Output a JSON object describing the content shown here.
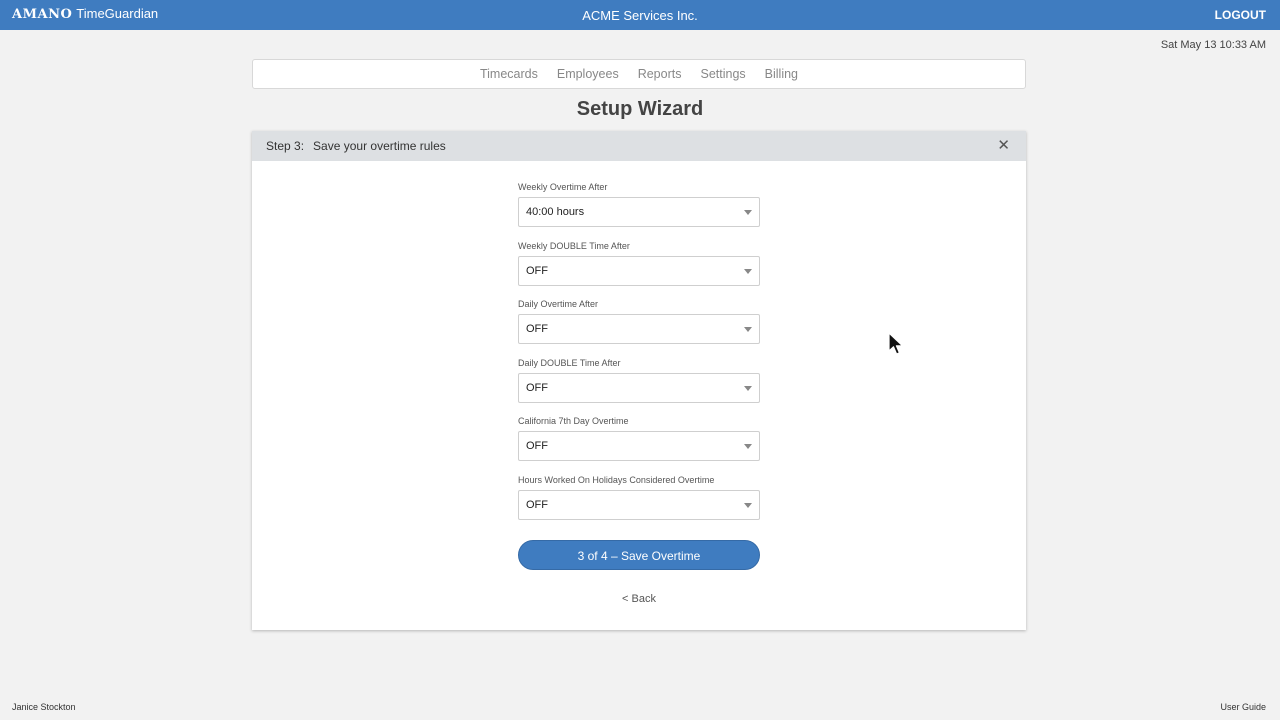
{
  "header": {
    "brand_primary": "AMANO",
    "brand_secondary": "TimeGuardian",
    "company": "ACME Services Inc.",
    "logout_label": "LOGOUT",
    "datetime": "Sat May 13 10:33 AM"
  },
  "nav": {
    "items": [
      {
        "label": "Timecards"
      },
      {
        "label": "Employees"
      },
      {
        "label": "Reports"
      },
      {
        "label": "Settings"
      },
      {
        "label": "Billing"
      }
    ]
  },
  "page": {
    "title": "Setup Wizard"
  },
  "wizard": {
    "step_number": "Step 3:",
    "step_title": "Save your overtime rules",
    "close_glyph": "✕",
    "fields": [
      {
        "label": "Weekly Overtime After",
        "value": "40:00 hours"
      },
      {
        "label": "Weekly DOUBLE Time After",
        "value": "OFF"
      },
      {
        "label": "Daily Overtime After",
        "value": "OFF"
      },
      {
        "label": "Daily DOUBLE Time After",
        "value": "OFF"
      },
      {
        "label": "California 7th Day Overtime",
        "value": "OFF"
      },
      {
        "label": "Hours Worked On Holidays Considered Overtime",
        "value": "OFF"
      }
    ],
    "primary_button": "3 of 4 – Save Overtime",
    "back_link": "< Back"
  },
  "footer": {
    "user_name": "Janice Stockton",
    "user_guide": "User Guide"
  },
  "colors": {
    "accent": "#3f7cc0",
    "header_bar": "#dde0e3",
    "background": "#f2f2f2"
  }
}
